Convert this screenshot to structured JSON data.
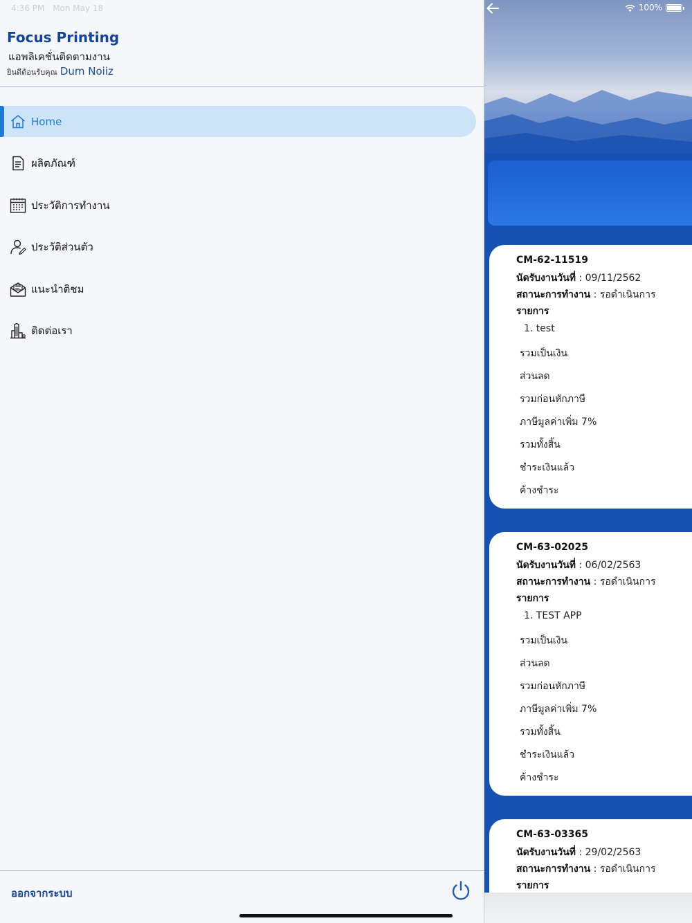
{
  "status_bar": {
    "time": "4:36 PM",
    "date": "Mon May 18",
    "battery": "100%"
  },
  "drawer": {
    "app_name": "Focus Printing",
    "app_subtitle": "แอพลิเคชั่นติดตามงาน",
    "welcome_prefix": "ยินดีต้อนรับคุณ",
    "user_name": "Dum Noiiz",
    "menu": [
      {
        "label": "Home",
        "icon": "home-icon",
        "active": true
      },
      {
        "label": "ผลิตภัณฑ์",
        "icon": "document-icon",
        "active": false
      },
      {
        "label": "ประวัติการทำงาน",
        "icon": "calendar-icon",
        "active": false
      },
      {
        "label": "ประวัติส่วนตัว",
        "icon": "user-edit-icon",
        "active": false
      },
      {
        "label": "แนะนำติชม",
        "icon": "mail-icon",
        "active": false
      },
      {
        "label": "ติดต่อเรา",
        "icon": "building-icon",
        "active": false
      }
    ],
    "logout_label": "ออกจากระบบ",
    "logout_icon": "power-icon"
  },
  "jobs": [
    {
      "id": "CM-62-11519",
      "date_label": "นัดรับงานวันที่",
      "date_value": "09/11/2562",
      "status_label": "สถานะการทำงาน",
      "status_value": "รอดำเนินการ",
      "items_label": "รายการ",
      "items": [
        "1. test"
      ],
      "rows": [
        "รวมเป็นเงิน",
        "ส่วนลด",
        "รวมก่อนหักภาษี",
        "ภาษีมูลค่าเพิ่ม 7%",
        "รวมทั้งสิ้น",
        "ชำระเงินแล้ว",
        "ค้างชำระ"
      ]
    },
    {
      "id": "CM-63-02025",
      "date_label": "นัดรับงานวันที่",
      "date_value": "06/02/2563",
      "status_label": "สถานะการทำงาน",
      "status_value": "รอดำเนินการ",
      "items_label": "รายการ",
      "items": [
        "1. TEST APP"
      ],
      "rows": [
        "รวมเป็นเงิน",
        "ส่วนลด",
        "รวมก่อนหักภาษี",
        "ภาษีมูลค่าเพิ่ม 7%",
        "รวมทั้งสิ้น",
        "ชำระเงินแล้ว",
        "ค้างชำระ"
      ]
    },
    {
      "id": "CM-63-03365",
      "date_label": "นัดรับงานวันที่",
      "date_value": "29/02/2563",
      "status_label": "สถานะการทำงาน",
      "status_value": "รอดำเนินการ",
      "items_label": "รายการ"
    }
  ],
  "colors": {
    "brand": "#12449a",
    "accent": "#1f79d6",
    "active_bg": "#cde4f8",
    "panel_blue": "#1451b3"
  }
}
